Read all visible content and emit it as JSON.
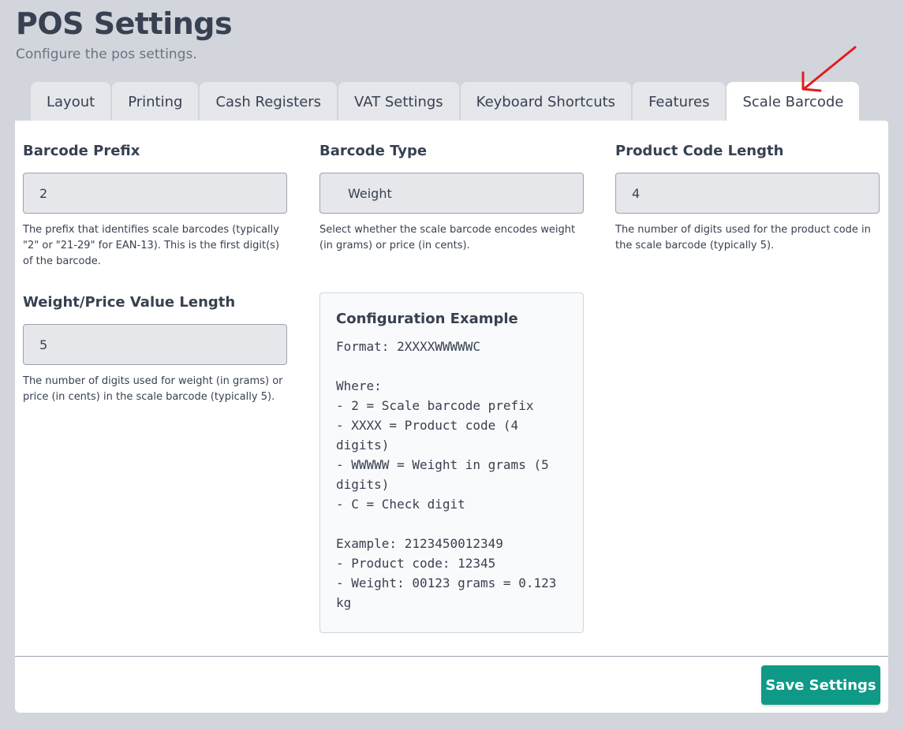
{
  "header": {
    "title": "POS Settings",
    "subtitle": "Configure the pos settings."
  },
  "tabs": [
    {
      "label": "Layout"
    },
    {
      "label": "Printing"
    },
    {
      "label": "Cash Registers"
    },
    {
      "label": "VAT Settings"
    },
    {
      "label": "Keyboard Shortcuts"
    },
    {
      "label": "Features"
    },
    {
      "label": "Scale Barcode"
    }
  ],
  "active_tab": "Scale Barcode",
  "fields": {
    "barcode_prefix": {
      "label": "Barcode Prefix",
      "value": "2",
      "help": "The prefix that identifies scale barcodes (typically \"2\" or \"21-29\" for EAN-13). This is the first digit(s) of the barcode."
    },
    "barcode_type": {
      "label": "Barcode Type",
      "value": "Weight",
      "help": "Select whether the scale barcode encodes weight (in grams) or price (in cents)."
    },
    "product_code_length": {
      "label": "Product Code Length",
      "value": "4",
      "help": "The number of digits used for the product code in the scale barcode (typically 5)."
    },
    "value_length": {
      "label": "Weight/Price Value Length",
      "value": "5",
      "help": "The number of digits used for weight (in grams) or price (in cents) in the scale barcode (typically 5)."
    }
  },
  "example": {
    "title": "Configuration Example",
    "body": "Format: 2XXXXWWWWWC\n\nWhere:\n- 2 = Scale barcode prefix\n- XXXX = Product code (4 digits)\n- WWWWW = Weight in grams (5 digits)\n- C = Check digit\n\nExample: 2123450012349\n- Product code: 12345\n- Weight: 00123 grams = 0.123 kg"
  },
  "footer": {
    "save_label": "Save Settings"
  },
  "colors": {
    "background": "#d3d5dc",
    "accent": "#0f9a87",
    "annotation_arrow": "#e11d1d"
  }
}
